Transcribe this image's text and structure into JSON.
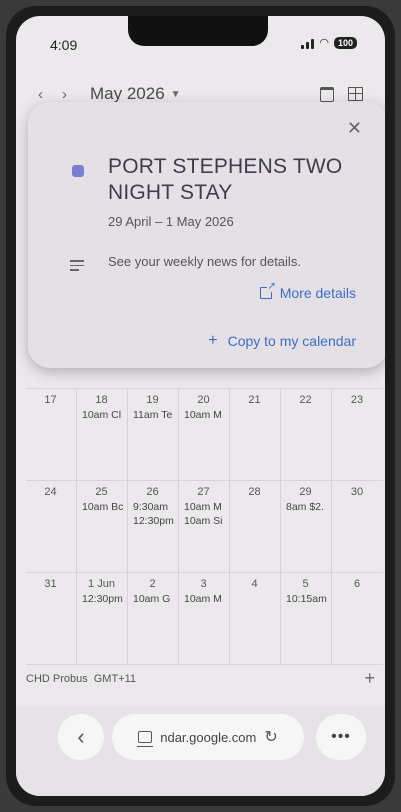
{
  "status": {
    "time": "4:09",
    "battery": "100"
  },
  "header": {
    "prev_icon": "chevron-left-icon",
    "next_icon": "chevron-right-icon",
    "month": "May 2026"
  },
  "popup": {
    "title": "PORT STEPHENS TWO NIGHT STAY",
    "date": "29 April – 1 May 2026",
    "description": "See your weekly news for details.",
    "more_details": "More details",
    "copy": "Copy to my calendar",
    "dot_color": "#7b7fd1"
  },
  "calendar": {
    "weeks": [
      {
        "days": [
          {
            "num": "17",
            "events": []
          },
          {
            "num": "18",
            "events": [
              "10am Cl"
            ]
          },
          {
            "num": "19",
            "events": [
              "11am Te"
            ]
          },
          {
            "num": "20",
            "events": [
              "10am M"
            ]
          },
          {
            "num": "21",
            "events": []
          },
          {
            "num": "22",
            "events": []
          },
          {
            "num": "23",
            "events": []
          }
        ]
      },
      {
        "days": [
          {
            "num": "24",
            "events": []
          },
          {
            "num": "25",
            "events": [
              "10am Bc"
            ]
          },
          {
            "num": "26",
            "events": [
              "9:30am",
              "12:30pm"
            ]
          },
          {
            "num": "27",
            "events": [
              "10am M",
              "10am Si"
            ]
          },
          {
            "num": "28",
            "events": []
          },
          {
            "num": "29",
            "events": [
              "8am $2."
            ]
          },
          {
            "num": "30",
            "events": []
          }
        ]
      },
      {
        "days": [
          {
            "num": "31",
            "events": []
          },
          {
            "num": "1 Jun",
            "events": [
              "12:30pm"
            ]
          },
          {
            "num": "2",
            "events": [
              "10am G"
            ]
          },
          {
            "num": "3",
            "events": [
              "10am M"
            ]
          },
          {
            "num": "4",
            "events": []
          },
          {
            "num": "5",
            "events": [
              "10:15am"
            ]
          },
          {
            "num": "6",
            "events": []
          }
        ]
      }
    ]
  },
  "footer": {
    "calendar_name": "CHD Probus",
    "timezone": "GMT+11"
  },
  "browser": {
    "url": "ndar.google.com",
    "more": "•••"
  }
}
